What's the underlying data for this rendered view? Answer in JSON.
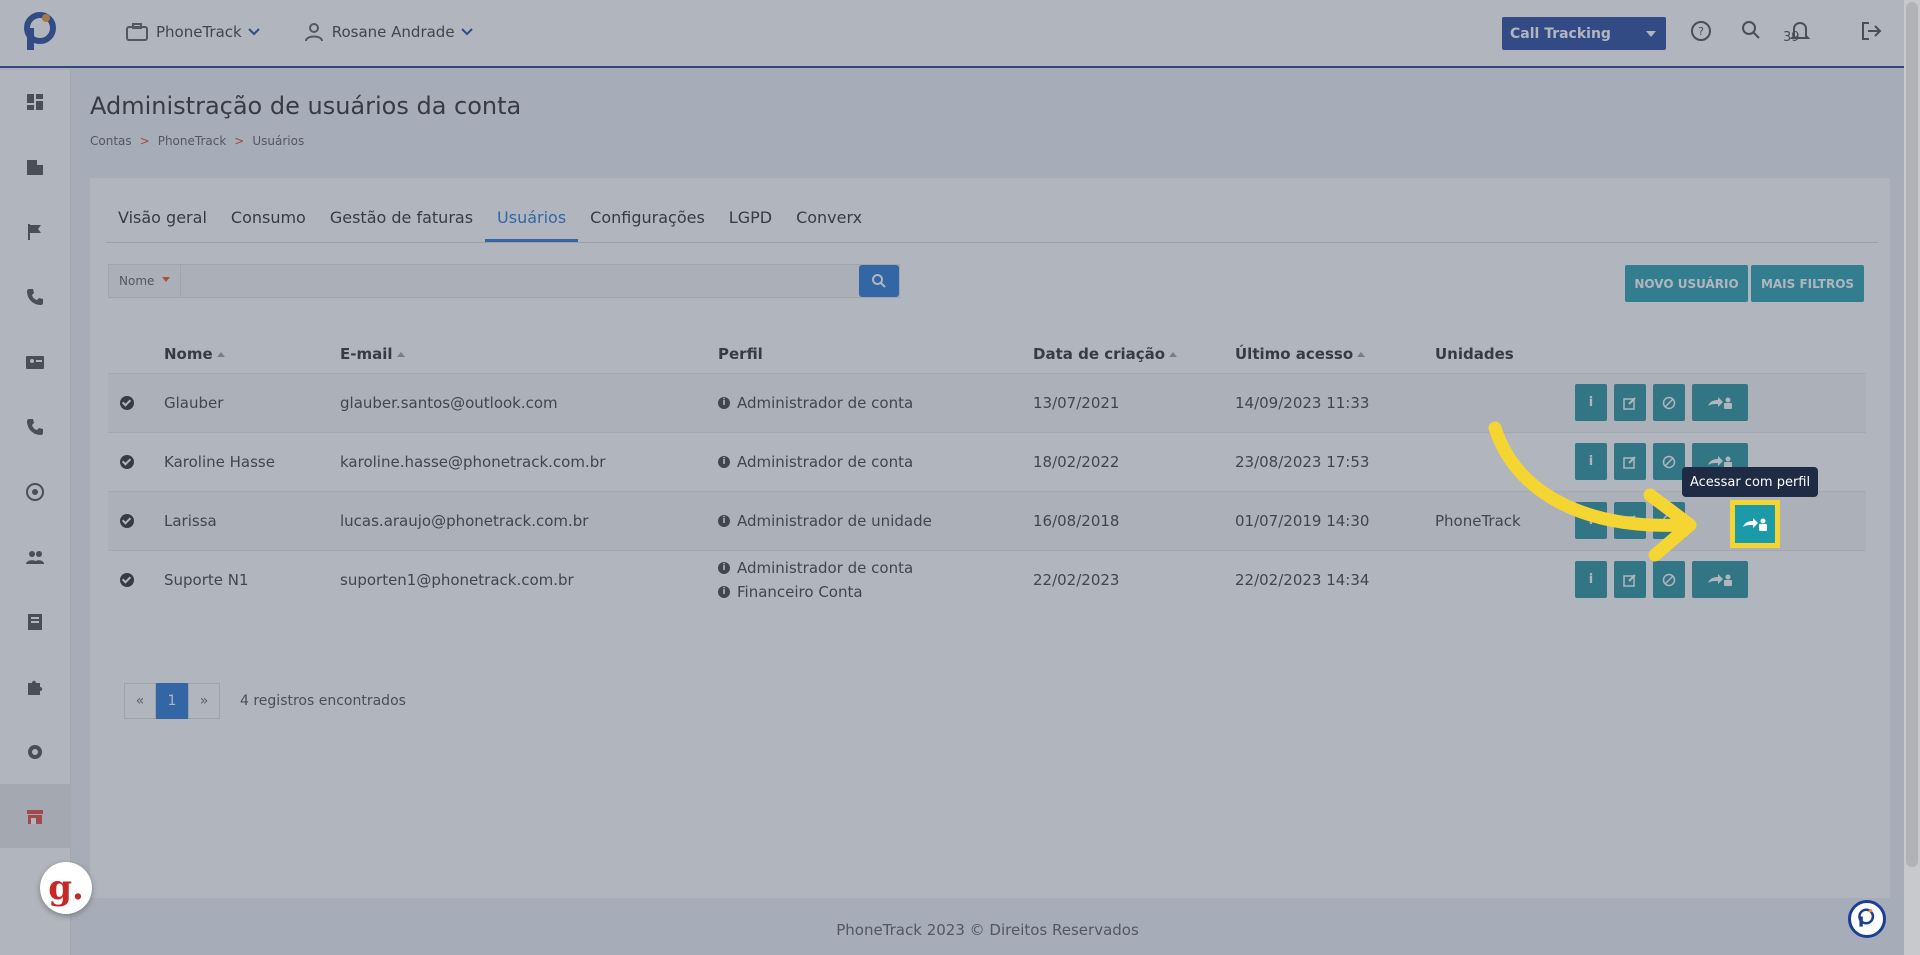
{
  "topbar": {
    "account_menu": "PhoneTrack",
    "user_menu": "Rosane Andrade",
    "product_select": "Call Tracking",
    "notifications_count": "39"
  },
  "page": {
    "title": "Administração de usuários da conta",
    "breadcrumb": [
      "Contas",
      "PhoneTrack",
      "Usuários"
    ]
  },
  "tabs": [
    "Visão geral",
    "Consumo",
    "Gestão de faturas",
    "Usuários",
    "Configurações",
    "LGPD",
    "Converx"
  ],
  "active_tab": "Usuários",
  "search": {
    "filter_label": "Nome",
    "placeholder": ""
  },
  "buttons": {
    "new_user": "NOVO USUÁRIO",
    "more_filters": "MAIS FILTROS"
  },
  "table": {
    "headers": [
      "Nome",
      "E-mail",
      "Perfil",
      "Data de criação",
      "Último acesso",
      "Unidades"
    ],
    "rows": [
      {
        "name": "Glauber",
        "email": "glauber.santos@outlook.com",
        "profiles": [
          "Administrador de conta"
        ],
        "created": "13/07/2021",
        "last_access": "14/09/2023 11:33",
        "units": ""
      },
      {
        "name": "Karoline Hasse",
        "email": "karoline.hasse@phonetrack.com.br",
        "profiles": [
          "Administrador de conta"
        ],
        "created": "18/02/2022",
        "last_access": "23/08/2023 17:53",
        "units": ""
      },
      {
        "name": "Larissa",
        "email": "lucas.araujo@phonetrack.com.br",
        "profiles": [
          "Administrador de unidade"
        ],
        "created": "16/08/2018",
        "last_access": "01/07/2019 14:30",
        "units": "PhoneTrack"
      },
      {
        "name": "Suporte N1",
        "email": "suporten1@phonetrack.com.br",
        "profiles": [
          "Administrador de conta",
          "Financeiro Conta"
        ],
        "created": "22/02/2023",
        "last_access": "22/02/2023 14:34",
        "units": ""
      }
    ]
  },
  "pagination": {
    "prev": "«",
    "current": "1",
    "next": "»",
    "summary": "4 registros encontrados"
  },
  "tooltip": "Acessar com perfil",
  "footer": "PhoneTrack 2023 © Direitos Reservados",
  "colors": {
    "primary": "#1b6fd1",
    "navy": "#1b3f97",
    "teal": "#1b9aa8",
    "highlight": "#f5d531"
  }
}
